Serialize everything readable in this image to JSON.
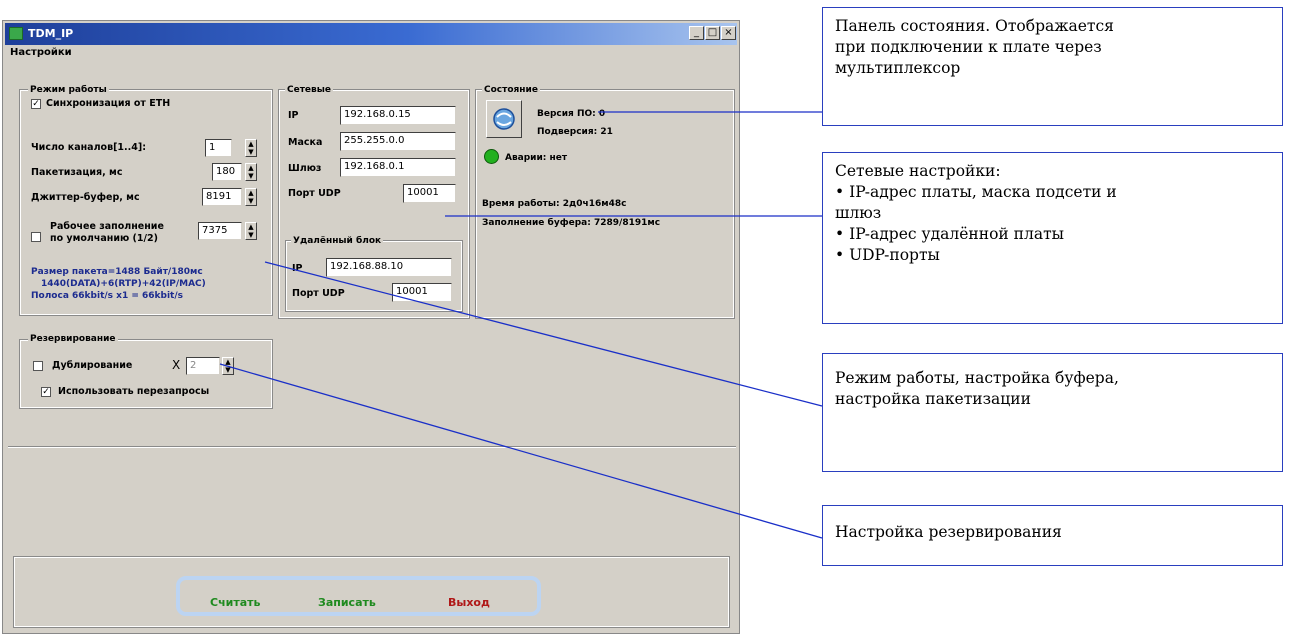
{
  "window": {
    "title": "TDM_IP",
    "menu": "Настройки",
    "controls": [
      "_",
      "□",
      "×"
    ]
  },
  "mode": {
    "group_title": "Режим работы",
    "sync_eth": {
      "label": "Синхронизация от ETH",
      "checked": true
    },
    "channels": {
      "label": "Число каналов[1..4]:",
      "value": "1"
    },
    "packetization": {
      "label": "Пакетизация, мс",
      "value": "180"
    },
    "jitter": {
      "label": "Джиттер-буфер, мс",
      "value": "8191"
    },
    "fill": {
      "label_line1": "Рабочее заполнение",
      "label_line2": "по умолчанию (1/2)",
      "value": "7375",
      "checked": false
    },
    "info_line1": "Размер пакета=1488 Байт/180мс",
    "info_line2": "1440(DATA)+6(RTP)+42(IP/MAC)",
    "info_line3": "Полоса 66kbit/s x1 = 66kbit/s"
  },
  "network": {
    "group_title": "Сетевые",
    "ip_label": "IP",
    "ip_value": "192.168.0.15",
    "mask_label": "Маска",
    "mask_value": "255.255.0.0",
    "gw_label": "Шлюз",
    "gw_value": "192.168.0.1",
    "udp_label": "Порт UDP",
    "udp_value": "10001"
  },
  "remote": {
    "group_title": "Удалённый блок",
    "ip_label": "IP",
    "ip_value": "192.168.88.10",
    "udp_label": "Порт UDP",
    "udp_value": "10001"
  },
  "status": {
    "group_title": "Состояние",
    "version": "Версия ПО: 0",
    "subversion": "Подверсия: 21",
    "alarm": "Аварии: нет",
    "alarm_color": "#22b01f",
    "uptime": "Время работы: 2д0ч16м48с",
    "buffer": "Заполнение буфера: 7289/8191мс"
  },
  "reserve": {
    "group_title": "Резервирование",
    "dup": {
      "label": "Дублирование",
      "checked": false,
      "x": "X",
      "value": "2"
    },
    "retry": {
      "label": "Использовать перезапросы",
      "checked": true
    }
  },
  "buttons": {
    "read": "Считать",
    "read_color": "#1f8a1f",
    "write": "Записать",
    "write_color": "#1f8a1f",
    "exit": "Выход",
    "exit_color": "#b01818"
  },
  "callouts": {
    "status_panel": {
      "line1": "Панель состояния. Отображается",
      "line2": "при подключении к плате через",
      "line3": "мультиплексор"
    },
    "network": {
      "line1": "Сетевые настройки:",
      "line2": "• IP-адрес платы, маска подсети и",
      "line3": "шлюз",
      "line4": "• IP-адрес удалённой платы",
      "line5": "• UDP-порты"
    },
    "mode": {
      "line1": "Режим работы, настройка буфера,",
      "line2": "настройка пакетизации"
    },
    "reserve": {
      "line1": "Настройка резервирования"
    }
  },
  "accent_line_color": "#1a2fc8"
}
